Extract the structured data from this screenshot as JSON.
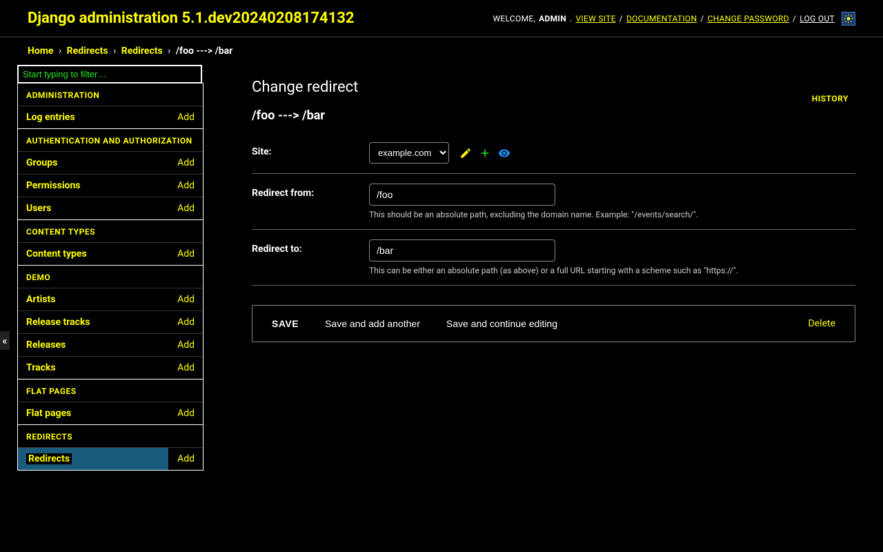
{
  "header": {
    "branding": "Django administration 5.1.dev20240208174132",
    "welcome": "WELCOME,",
    "user": "ADMIN",
    "view_site": "VIEW SITE",
    "documentation": "DOCUMENTATION",
    "change_password": "CHANGE PASSWORD",
    "logout": "LOG OUT"
  },
  "breadcrumbs": {
    "home": "Home",
    "app": "Redirects",
    "model": "Redirects",
    "current": "/foo ---> /bar"
  },
  "sidebar": {
    "filter_placeholder": "Start typing to filter…",
    "add_label": "Add",
    "sections": [
      {
        "caption": "ADMINISTRATION",
        "rows": [
          {
            "name": "Log entries"
          }
        ]
      },
      {
        "caption": "AUTHENTICATION AND AUTHORIZATION",
        "rows": [
          {
            "name": "Groups"
          },
          {
            "name": "Permissions"
          },
          {
            "name": "Users"
          }
        ]
      },
      {
        "caption": "CONTENT TYPES",
        "rows": [
          {
            "name": "Content types"
          }
        ]
      },
      {
        "caption": "DEMO",
        "rows": [
          {
            "name": "Artists"
          },
          {
            "name": "Release tracks"
          },
          {
            "name": "Releases"
          },
          {
            "name": "Tracks"
          }
        ]
      },
      {
        "caption": "FLAT PAGES",
        "rows": [
          {
            "name": "Flat pages"
          }
        ]
      },
      {
        "caption": "REDIRECTS",
        "rows": [
          {
            "name": "Redirects",
            "selected": true
          }
        ]
      }
    ]
  },
  "content": {
    "title": "Change redirect",
    "history": "HISTORY",
    "object_label": "/foo ---> /bar",
    "fields": {
      "site": {
        "label": "Site:",
        "value": "example.com"
      },
      "old_path": {
        "label": "Redirect from:",
        "value": "/foo",
        "help": "This should be an absolute path, excluding the domain name. Example: \"/events/search/\"."
      },
      "new_path": {
        "label": "Redirect to:",
        "value": "/bar",
        "help": "This can be either an absolute path (as above) or a full URL starting with a scheme such as \"https://\"."
      }
    },
    "buttons": {
      "save": "SAVE",
      "save_add": "Save and add another",
      "save_continue": "Save and continue editing",
      "delete": "Delete"
    }
  }
}
